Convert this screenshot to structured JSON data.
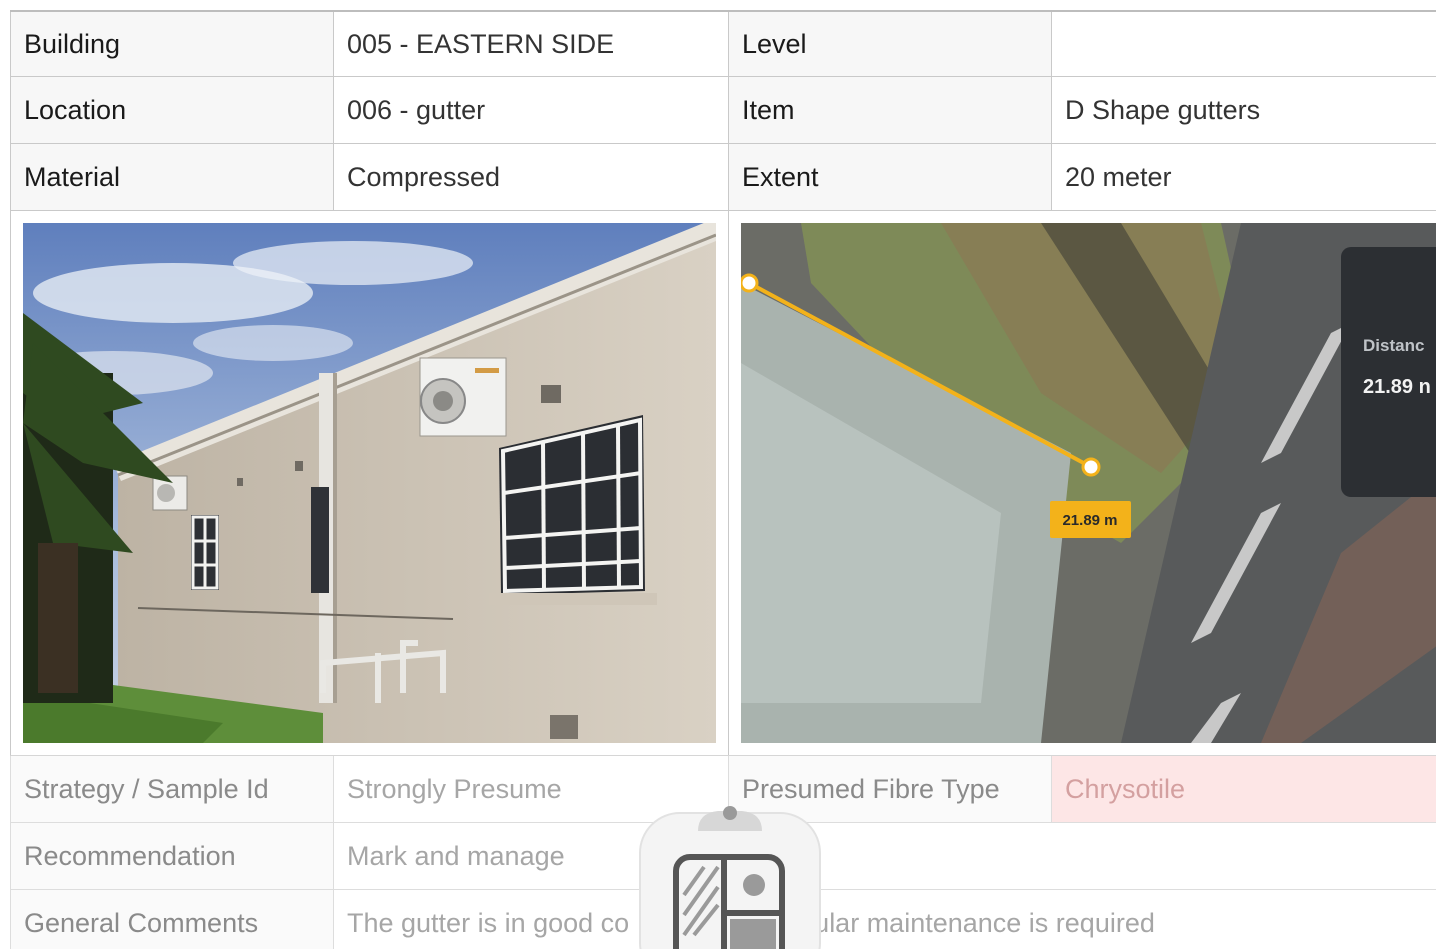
{
  "rows": [
    {
      "label1": "Building",
      "value1": "005 - EASTERN SIDE",
      "label2": "Level",
      "value2": ""
    },
    {
      "label1": "Location",
      "value1": "006 - gutter",
      "label2": "Item",
      "value2": "D Shape gutters"
    },
    {
      "label1": "Material",
      "value1": "Compressed",
      "label2": "Extent",
      "value2": "20 meter"
    }
  ],
  "map_photo": {
    "measure_badge": "21.89 m",
    "panel_title": "Distanc",
    "panel_value": "21.89 n"
  },
  "lower_rows": [
    {
      "label1": "Strategy / Sample Id",
      "value1": "Strongly Presume",
      "label2": "Presumed Fibre Type",
      "value2": "Chrysotile"
    },
    {
      "label": "Recommendation",
      "value": "Mark and manage"
    },
    {
      "label": "General Comments",
      "value": "The gutter is in good condition. Regular maintenance is required",
      "visible_left": "The gutter is in good co",
      "visible_right": "ular maintenance is required"
    }
  ],
  "colors": {
    "measure_line": "#f3b21a",
    "pink_cell": "#fde6e6"
  },
  "overlay_icon": "clipboard-gallery-icon"
}
